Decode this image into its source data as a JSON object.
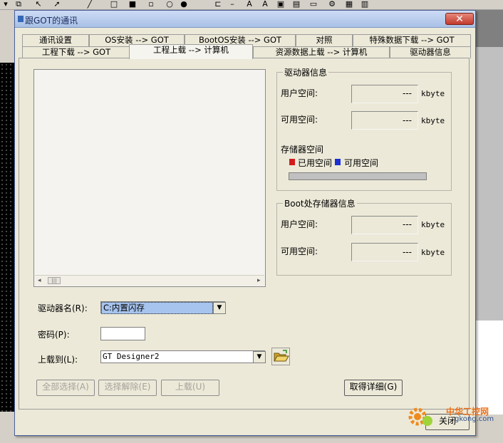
{
  "dialog": {
    "title": "跟GOT的通讯",
    "close_glyph": "✕"
  },
  "tabs": {
    "row1": [
      "通讯设置",
      "OS安装 --> GOT",
      "BootOS安装 --> GOT",
      "对照",
      "特殊数据下载 --> GOT"
    ],
    "row2": [
      "工程下载 --> GOT",
      "工程上载 --> 计算机",
      "资源数据上载 --> 计算机",
      "驱动器信息"
    ],
    "selected": "工程上载 --> 计算机"
  },
  "drive_info": {
    "title": "驱动器信息",
    "user_space_label": "用户空间:",
    "free_space_label": "可用空间:",
    "user_space_value": "---",
    "free_space_value": "---",
    "unit": "kbyte",
    "storage_label": "存储器空间",
    "used_legend": "已用空间",
    "free_legend": "可用空间",
    "used_fraction": 0,
    "used_color": "#d41b1b",
    "free_color": "#1b2fd4"
  },
  "boot_info": {
    "title": "Boot处存储器信息",
    "user_space_label": "用户空间:",
    "free_space_label": "可用空间:",
    "user_space_value": "---",
    "free_space_value": "---",
    "unit": "kbyte"
  },
  "form": {
    "drive_name_label": "驱动器名(R):",
    "drive_name_value": "C:内置闪存",
    "password_label": "密码(P):",
    "password_value": "",
    "upload_to_label": "上载到(L):",
    "upload_to_value": "GT Designer2"
  },
  "buttons": {
    "select_all": "全部选择(A)",
    "deselect": "选择解除(E)",
    "upload": "上载(U)",
    "get_details": "取得详细(G)",
    "close": "关闭"
  },
  "icons": {
    "folder": "folder-open-icon",
    "scroll_left": "◂",
    "scroll_right": "▸",
    "dropdown": "▼"
  },
  "watermark": {
    "text": "中华工控网",
    "url": "gkong.com"
  }
}
